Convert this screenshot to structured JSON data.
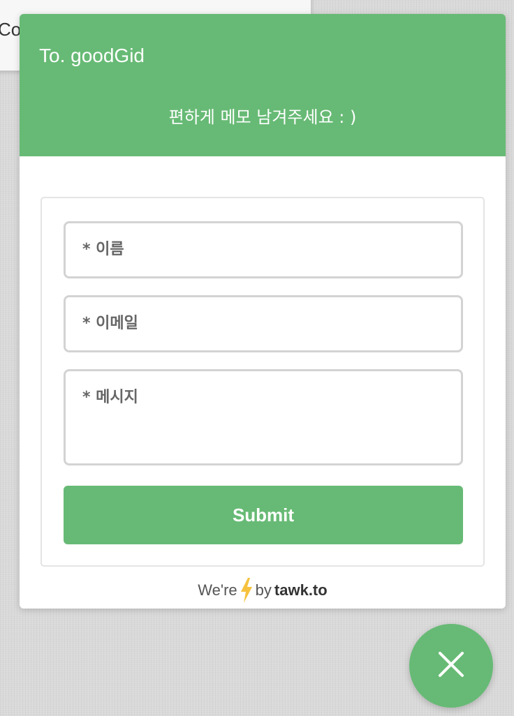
{
  "background": {
    "partial_text": "Co"
  },
  "widget": {
    "title": "To. goodGid",
    "subtitle": "편하게 메모 남겨주세요 : )",
    "accent_color": "#67ba75"
  },
  "form": {
    "name_placeholder": "* 이름",
    "email_placeholder": "* 이메일",
    "message_placeholder": "* 메시지",
    "submit_label": "Submit"
  },
  "footer": {
    "prefix": "We're",
    "icon": "lightning-bolt-icon",
    "by": "by",
    "brand": "tawk.to"
  },
  "fab": {
    "icon": "close-icon"
  }
}
